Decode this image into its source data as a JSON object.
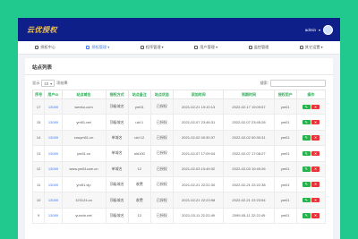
{
  "header": {
    "logo": "云优授权",
    "user": "admin",
    "chevron": "▾"
  },
  "nav": [
    {
      "label": "授权中心",
      "active": false
    },
    {
      "label": "授权管理 ▾",
      "active": true
    },
    {
      "label": "程序管理 ▾",
      "active": false
    },
    {
      "label": "用户管理 ▾",
      "active": false
    },
    {
      "label": "监控管理",
      "active": false
    },
    {
      "label": "其它设置 ▾",
      "active": false
    }
  ],
  "card": {
    "title": "站点列表"
  },
  "toolbar": {
    "show_label": "显示",
    "page_size": "10",
    "entries_label": "项结果",
    "search_label": "搜索:"
  },
  "table": {
    "headers": [
      "序号",
      "用户ID",
      "站点域名",
      "授权方式",
      "站点备注",
      "站点状态",
      "添加时间",
      "到期时间",
      "授权用户",
      "操作"
    ],
    "rows": [
      [
        "17",
        "13089",
        "weeku.com",
        "顶级域名",
        "ym01",
        "已授权",
        "2021-02-21 19:10:13",
        "2022-02-17 19:09:57",
        "ym01"
      ],
      [
        "15",
        "13089",
        "ym51.net",
        "顶级域名",
        "uid 1",
        "已授权",
        "2021-02-07 23:46:31",
        "2022-02-07 23:45:28",
        "ym01"
      ],
      [
        "14",
        "13089",
        "cnuym51.cn",
        "单域名",
        "uid 12",
        "已授权",
        "2021-02-02 00:30:37",
        "2022-02-02 00:30:31",
        "ym01"
      ],
      [
        "13",
        "13089",
        "ym51.cn",
        "单域名",
        "uid100",
        "已授权",
        "2021-02-07 17:09:04",
        "2022-02-07 17:08:27",
        "ym01"
      ],
      [
        "12",
        "13089",
        "www.ym51com.cn",
        "单域名",
        "12",
        "已授权",
        "2021-02-03 10:49:32",
        "2022-02-03 10:49:26",
        "ym01"
      ],
      [
        "11",
        "13089",
        "ym51.vip",
        "顶级域名",
        "收费",
        "已授权",
        "2021-02-21 22:22:30",
        "2022-02-21 22:22:38",
        "ym01"
      ],
      [
        "10",
        "13089",
        "123124.cn",
        "顶级域名",
        "收费",
        "已授权",
        "2021-02-21 22:23:58",
        "2022-02-21 22:23:54",
        "ym01"
      ],
      [
        "9",
        "13089",
        "yunxin.net",
        "顶级域名",
        "12",
        "已授权",
        "2021-03-11 22:22:49",
        "2099-05-11 22:22:49",
        "ym01"
      ]
    ],
    "edit_icon": "edit-icon",
    "delete_icon": "trash-icon"
  }
}
